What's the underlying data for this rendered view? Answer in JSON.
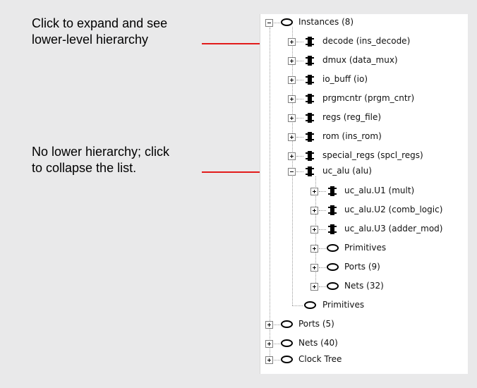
{
  "callouts": {
    "expand_line1": "Click to expand and see",
    "expand_line2": "lower-level hierarchy",
    "collapse_line1": "No lower hierarchy; click",
    "collapse_line2": "to collapse the list."
  },
  "tree": {
    "root": "Instances (8)",
    "instances": [
      "decode (ins_decode)",
      "dmux (data_mux)",
      "io_buff (io)",
      "prgmcntr (prgm_cntr)",
      "regs (reg_file)",
      "rom (ins_rom)",
      "special_regs (spcl_regs)",
      "uc_alu (alu)"
    ],
    "uc_alu_children": [
      "uc_alu.U1 (mult)",
      "uc_alu.U2 (comb_logic)",
      "uc_alu.U3 (adder_mod)",
      "Primitives",
      "Ports (9)",
      "Nets (32)"
    ],
    "instances_primitives": "Primitives",
    "top_level": [
      "Ports (5)",
      "Nets (40)",
      "Clock Tree"
    ]
  },
  "colors": {
    "arrow": "#e21b1b",
    "background": "#e9e9ea",
    "panel": "#ffffff"
  },
  "icons": {
    "oval": "oval-node-icon",
    "chip": "chip-instance-icon",
    "plus": "expand-plus-icon",
    "minus": "collapse-minus-icon"
  }
}
